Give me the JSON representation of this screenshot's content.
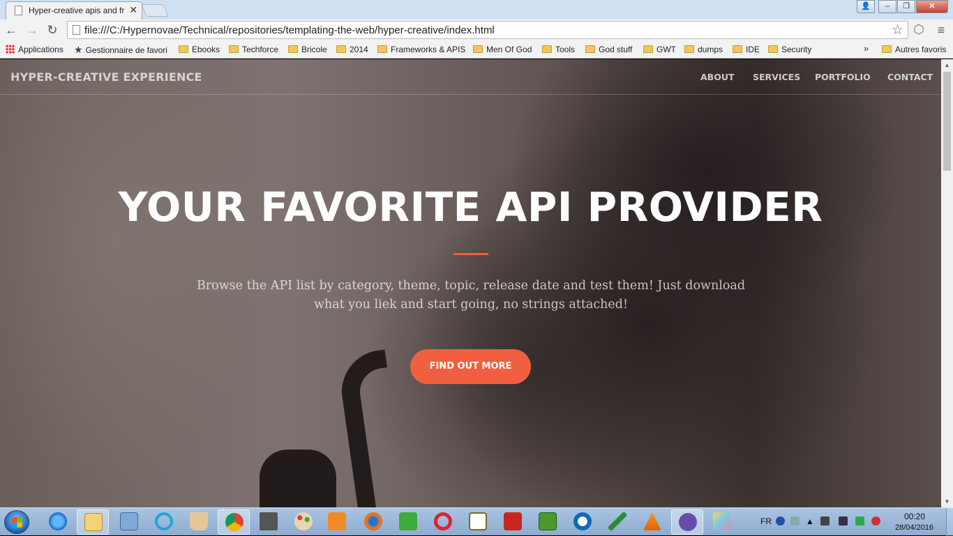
{
  "browser": {
    "tab_title": "Hyper-creative apis and fr",
    "url": "file:///C:/Hypernovae/Technical/repositories/templating-the-web/hyper-creative/index.html",
    "bookmarks": [
      {
        "label": "Applications",
        "icon": "apps-icon"
      },
      {
        "label": "Gestionnaire de favori",
        "icon": "star-icon"
      },
      {
        "label": "Ebooks",
        "icon": "folder-icon"
      },
      {
        "label": "Techforce",
        "icon": "folder-icon"
      },
      {
        "label": "Bricole",
        "icon": "folder-icon"
      },
      {
        "label": "2014",
        "icon": "folder-icon"
      },
      {
        "label": "Frameworks & APIS",
        "icon": "folder-icon"
      },
      {
        "label": "Men Of God",
        "icon": "folder-icon"
      },
      {
        "label": "Tools",
        "icon": "folder-icon"
      },
      {
        "label": "God stuff",
        "icon": "folder-icon"
      },
      {
        "label": "GWT",
        "icon": "folder-icon"
      },
      {
        "label": "dumps",
        "icon": "folder-icon"
      },
      {
        "label": "IDE",
        "icon": "folder-icon"
      },
      {
        "label": "Security",
        "icon": "folder-icon"
      }
    ],
    "bookmarks_more": "»",
    "other_bookmarks": "Autres favoris"
  },
  "site": {
    "brand": "HYPER-CREATIVE EXPERIENCE",
    "nav": [
      "ABOUT",
      "SERVICES",
      "PORTFOLIO",
      "CONTACT"
    ],
    "hero_title": "YOUR FAVORITE API PROVIDER",
    "hero_subtitle": "Browse the API list by category, theme, topic, release date and test them! Just download what you liek and start going, no strings attached!",
    "cta_label": "FIND OUT MORE",
    "accent_color": "#f05f40"
  },
  "taskbar": {
    "language": "FR",
    "time": "00:20",
    "date": "28/04/2016",
    "apps": [
      "internet-explorer",
      "file-explorer",
      "remote-desktop",
      "cortana-app",
      "coffee-app",
      "chrome",
      "laptop-tool",
      "paint-app",
      "media-player",
      "firefox",
      "odnoklassniki",
      "opera",
      "wordpad-app",
      "acrobat-reader",
      "spreadsheet-app",
      "teamviewer",
      "paper-plane-app",
      "vlc",
      "cat-app",
      "map-app"
    ]
  }
}
